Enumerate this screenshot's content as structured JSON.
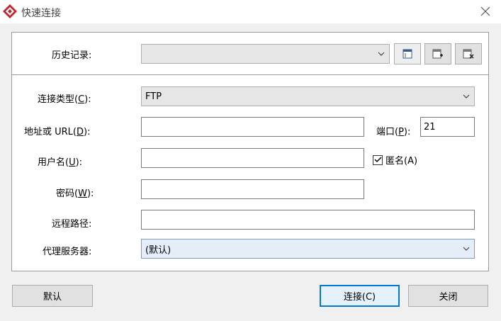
{
  "window": {
    "title": "快速连接"
  },
  "history": {
    "label": "历史记录:",
    "value": ""
  },
  "connection_type": {
    "label_prefix": "连接类型(",
    "label_key": "C",
    "label_suffix": "):",
    "value": "FTP"
  },
  "address": {
    "label_prefix": "地址或 URL(",
    "label_key": "D",
    "label_suffix": "):",
    "value": ""
  },
  "port": {
    "label_prefix": "端口(",
    "label_key": "P",
    "label_suffix": "):",
    "value": "21"
  },
  "username": {
    "label_prefix": "用户名(",
    "label_key": "U",
    "label_suffix": "):",
    "value": ""
  },
  "anonymous": {
    "label": "匿名(A)",
    "checked": true
  },
  "password": {
    "label_prefix": "密码(",
    "label_key": "W",
    "label_suffix": "):",
    "value": ""
  },
  "remote_path": {
    "label": "远程路径:",
    "value": ""
  },
  "proxy": {
    "label": "代理服务器:",
    "value": "(默认)"
  },
  "buttons": {
    "default": "默认",
    "connect": "连接(C)",
    "close": "关闭"
  },
  "colors": {
    "app_icon": "#c1272d",
    "focus_border": "#0078d7"
  },
  "icons": {
    "app": "app-logo-icon",
    "close": "close-icon",
    "history_actions": [
      "view-icon",
      "add-icon",
      "delete-icon"
    ]
  }
}
